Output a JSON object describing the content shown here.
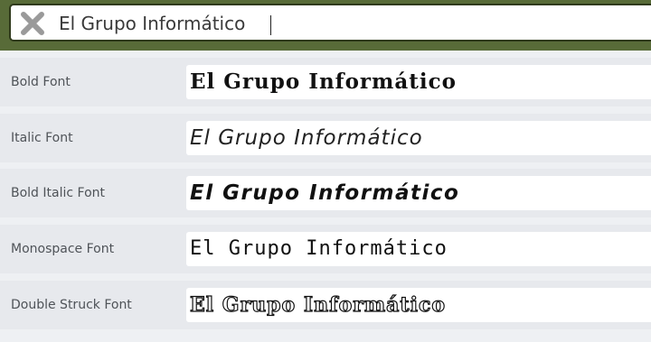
{
  "search": {
    "value": "El Grupo Informático"
  },
  "icons": {
    "clear": "close-icon"
  },
  "colors": {
    "topbar": "#586b38",
    "row_background": "#e7e9ed",
    "output_background": "#ffffff"
  },
  "rows": [
    {
      "label": "Bold Font",
      "output": "El Grupo Informático"
    },
    {
      "label": "Italic Font",
      "output": "El Grupo Informático"
    },
    {
      "label": "Bold Italic Font",
      "output": "El Grupo Informático"
    },
    {
      "label": "Monospace Font",
      "output": "El Grupo Informático"
    },
    {
      "label": "Double Struck Font",
      "output": "El Grupo Informático"
    }
  ]
}
